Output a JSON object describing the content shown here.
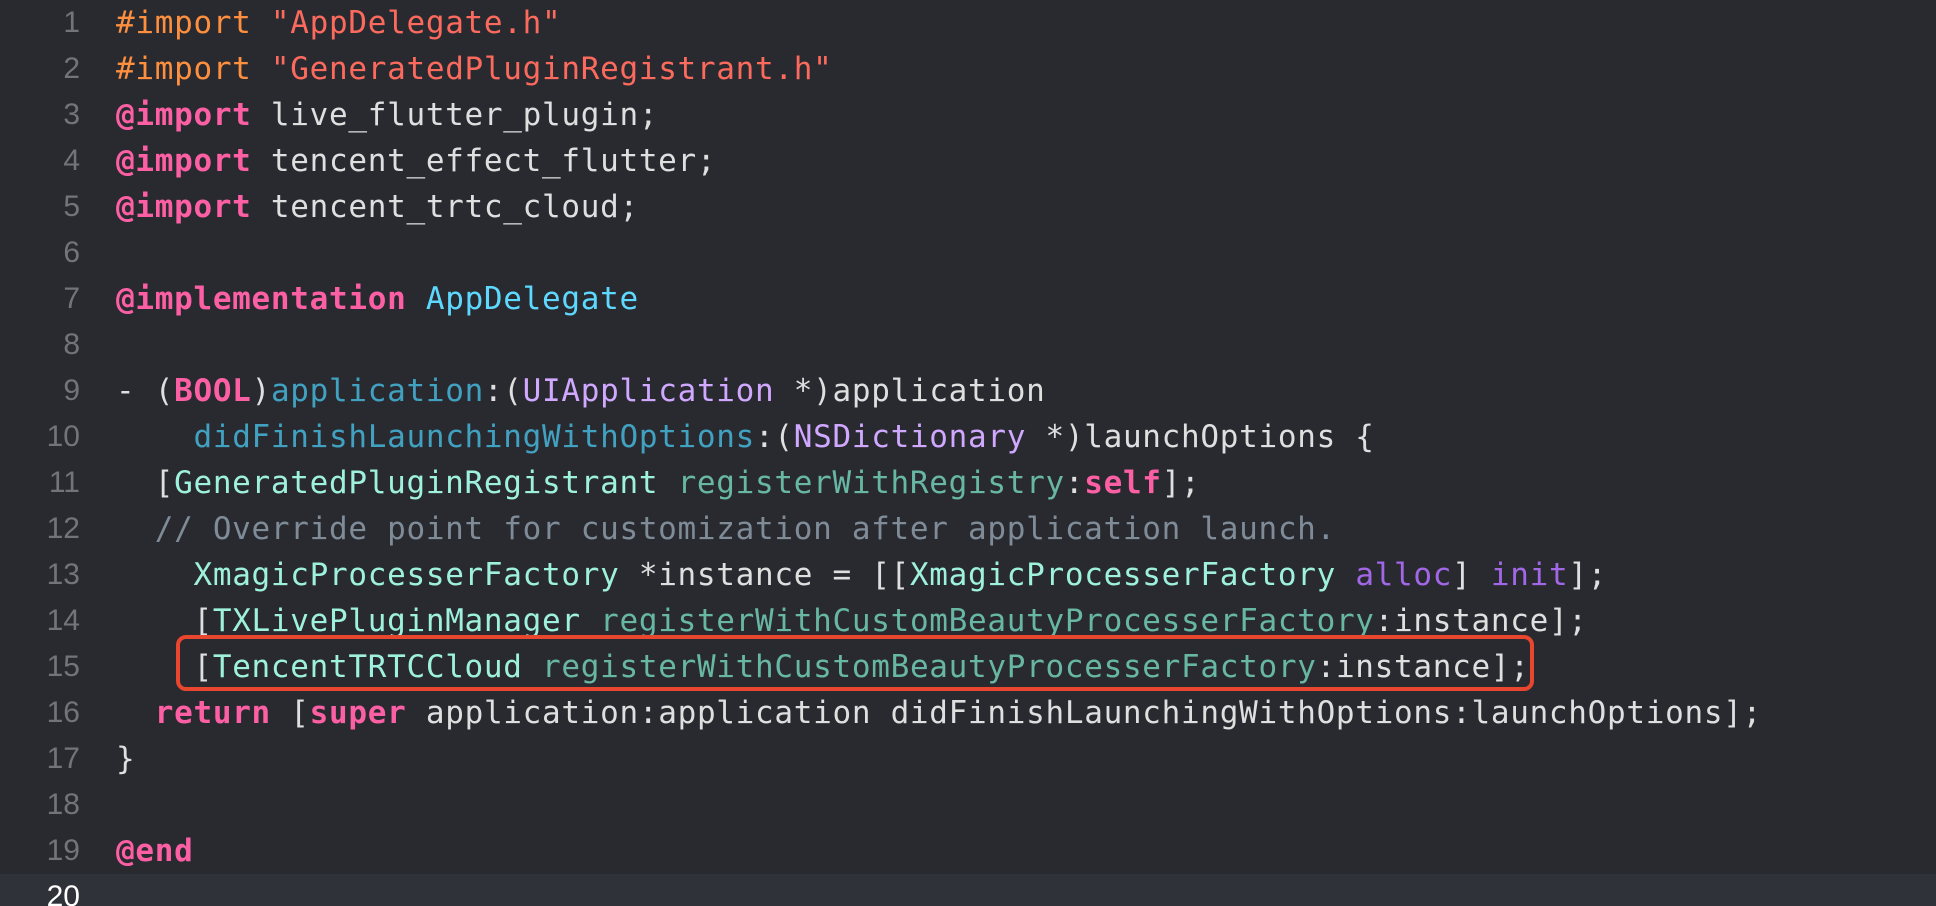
{
  "colors": {
    "background": "#292a30",
    "current_line": "#2f3239",
    "line_number": "#747478",
    "highlight_box": "#e8462f"
  },
  "editor": {
    "current_line": 20,
    "lines": [
      {
        "n": "1",
        "tokens": [
          {
            "t": "#import ",
            "c": "pre"
          },
          {
            "t": "\"AppDelegate.h\"",
            "c": "str"
          }
        ]
      },
      {
        "n": "2",
        "tokens": [
          {
            "t": "#import ",
            "c": "pre"
          },
          {
            "t": "\"GeneratedPluginRegistrant.h\"",
            "c": "str"
          }
        ]
      },
      {
        "n": "3",
        "tokens": [
          {
            "t": "@import",
            "c": "kw"
          },
          {
            "t": " live_flutter_plugin;",
            "c": "plain"
          }
        ]
      },
      {
        "n": "4",
        "tokens": [
          {
            "t": "@import",
            "c": "kw"
          },
          {
            "t": " tencent_effect_flutter;",
            "c": "plain"
          }
        ]
      },
      {
        "n": "5",
        "tokens": [
          {
            "t": "@import",
            "c": "kw"
          },
          {
            "t": " tencent_trtc_cloud;",
            "c": "plain"
          }
        ]
      },
      {
        "n": "6",
        "tokens": []
      },
      {
        "n": "7",
        "tokens": [
          {
            "t": "@implementation",
            "c": "kw"
          },
          {
            "t": " ",
            "c": "plain"
          },
          {
            "t": "AppDelegate",
            "c": "decl"
          }
        ]
      },
      {
        "n": "8",
        "tokens": []
      },
      {
        "n": "9",
        "tokens": [
          {
            "t": "- (",
            "c": "plain"
          },
          {
            "t": "BOOL",
            "c": "kw"
          },
          {
            "t": ")",
            "c": "plain"
          },
          {
            "t": "application",
            "c": "func"
          },
          {
            "t": ":(",
            "c": "plain"
          },
          {
            "t": "UIApplication",
            "c": "type"
          },
          {
            "t": " *)application",
            "c": "plain"
          }
        ]
      },
      {
        "n": "10",
        "tokens": [
          {
            "t": "    ",
            "c": "plain"
          },
          {
            "t": "didFinishLaunchingWithOptions",
            "c": "func"
          },
          {
            "t": ":(",
            "c": "plain"
          },
          {
            "t": "NSDictionary",
            "c": "type"
          },
          {
            "t": " *)launchOptions {",
            "c": "plain"
          }
        ]
      },
      {
        "n": "11",
        "tokens": [
          {
            "t": "  [",
            "c": "plain"
          },
          {
            "t": "GeneratedPluginRegistrant",
            "c": "class"
          },
          {
            "t": " ",
            "c": "plain"
          },
          {
            "t": "registerWithRegistry",
            "c": "method"
          },
          {
            "t": ":",
            "c": "plain"
          },
          {
            "t": "self",
            "c": "kw"
          },
          {
            "t": "];",
            "c": "plain"
          }
        ]
      },
      {
        "n": "12",
        "tokens": [
          {
            "t": "  // Override point for customization after application launch.",
            "c": "cmt"
          }
        ]
      },
      {
        "n": "13",
        "tokens": [
          {
            "t": "    ",
            "c": "plain"
          },
          {
            "t": "XmagicProcesserFactory",
            "c": "proj"
          },
          {
            "t": " *instance = [[",
            "c": "plain"
          },
          {
            "t": "XmagicProcesserFactory",
            "c": "proj"
          },
          {
            "t": " ",
            "c": "plain"
          },
          {
            "t": "alloc",
            "c": "sysmeth"
          },
          {
            "t": "] ",
            "c": "plain"
          },
          {
            "t": "init",
            "c": "sysmeth"
          },
          {
            "t": "];",
            "c": "plain"
          }
        ]
      },
      {
        "n": "14",
        "tokens": [
          {
            "t": "    [",
            "c": "plain"
          },
          {
            "t": "TXLivePluginManager",
            "c": "proj"
          },
          {
            "t": " ",
            "c": "plain"
          },
          {
            "t": "registerWithCustomBeautyProcesserFactory",
            "c": "method"
          },
          {
            "t": ":instance];",
            "c": "plain"
          }
        ]
      },
      {
        "n": "15",
        "tokens": [
          {
            "t": "    [",
            "c": "plain"
          },
          {
            "t": "TencentTRTCCloud",
            "c": "proj"
          },
          {
            "t": " ",
            "c": "plain"
          },
          {
            "t": "registerWithCustomBeautyProcesserFactory",
            "c": "method"
          },
          {
            "t": ":instance];",
            "c": "plain"
          }
        ]
      },
      {
        "n": "16",
        "tokens": [
          {
            "t": "  ",
            "c": "plain"
          },
          {
            "t": "return",
            "c": "kw"
          },
          {
            "t": " [",
            "c": "plain"
          },
          {
            "t": "super",
            "c": "kw"
          },
          {
            "t": " application:application didFinishLaunchingWithOptions:launchOptions];",
            "c": "plain"
          }
        ]
      },
      {
        "n": "17",
        "tokens": [
          {
            "t": "}",
            "c": "plain"
          }
        ]
      },
      {
        "n": "18",
        "tokens": []
      },
      {
        "n": "19",
        "tokens": [
          {
            "t": "@end",
            "c": "kw"
          }
        ]
      },
      {
        "n": "20",
        "tokens": []
      }
    ]
  }
}
